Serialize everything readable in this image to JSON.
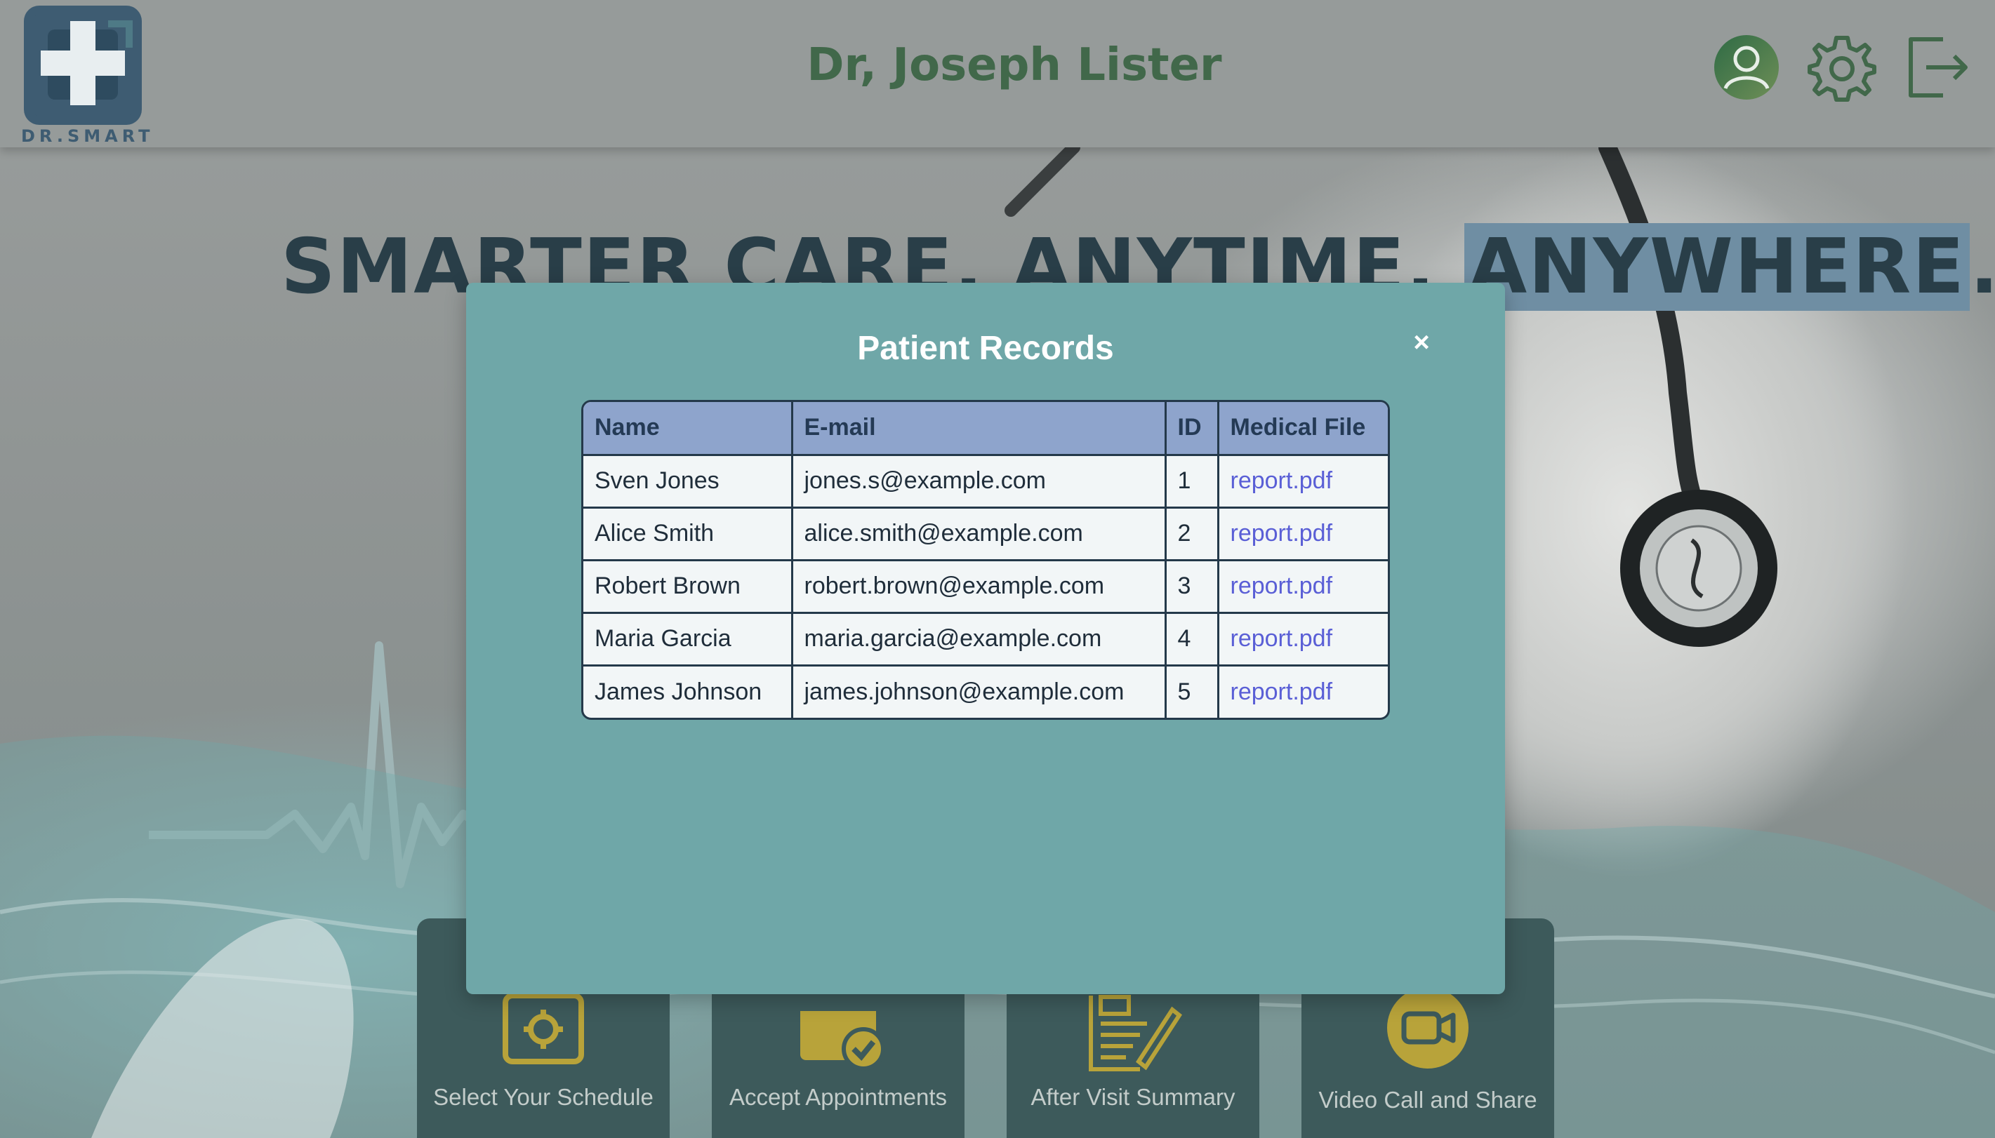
{
  "header": {
    "logo_text": "DR.SMART",
    "doctor_name": "Dr, Joseph Lister",
    "icons": [
      "profile-icon",
      "settings-icon",
      "logout-icon"
    ]
  },
  "hero": {
    "part1": "SMARTER CARE, ANYTIME, ",
    "highlight": "ANYWHERE",
    "end": "."
  },
  "cards": [
    {
      "label": "Select Your Schedule",
      "icon": "calendar-gear-icon"
    },
    {
      "label": "Accept Appointments",
      "icon": "calendar-check-icon"
    },
    {
      "label": "After Visit Summary",
      "icon": "document-pen-icon"
    },
    {
      "label": "Video Call and Share",
      "icon": "video-camera-icon"
    }
  ],
  "modal": {
    "title": "Patient Records",
    "close_symbol": "×",
    "columns": [
      "Name",
      "E-mail",
      "ID",
      "Medical File"
    ],
    "rows": [
      {
        "name": "Sven Jones",
        "email": "jones.s@example.com",
        "id": "1",
        "file": "report.pdf"
      },
      {
        "name": "Alice Smith",
        "email": "alice.smith@example.com",
        "id": "2",
        "file": "report.pdf"
      },
      {
        "name": "Robert Brown",
        "email": "robert.brown@example.com",
        "id": "3",
        "file": "report.pdf"
      },
      {
        "name": "Maria Garcia",
        "email": "maria.garcia@example.com",
        "id": "4",
        "file": "report.pdf"
      },
      {
        "name": "James Johnson",
        "email": "james.johnson@example.com",
        "id": "5",
        "file": "report.pdf"
      }
    ]
  },
  "colors": {
    "brand_green": "#41684a",
    "logo_blue": "#3e5c72",
    "modal_bg": "#6fa7a8",
    "table_header": "#8ea4cc",
    "link": "#5a5fd6",
    "card_bg": "#3d5a5b",
    "icon_yellow": "#b8a33a"
  }
}
